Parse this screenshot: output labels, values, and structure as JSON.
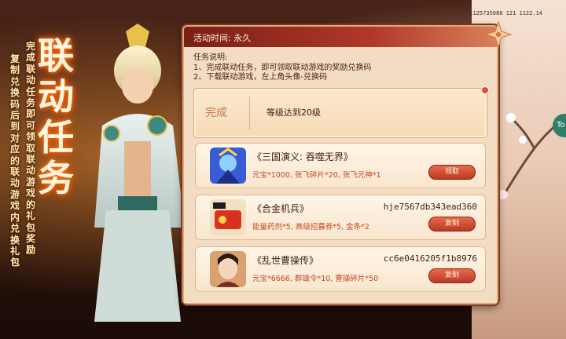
{
  "status_id": "1125735088 121 1122.14",
  "side_button_label": "To",
  "event": {
    "title_chars": [
      "联动",
      "任务"
    ],
    "vertical_cols": [
      "完成联动任务即可领取联动游戏的礼包奖励",
      "复制兑换码后到对应的联动游戏内兑换礼包"
    ]
  },
  "panel": {
    "activity_time": "活动时间: 永久",
    "description_lines": [
      "任务说明:",
      "1、完成联动任务，即可领取联动游戏的奖励兑换码",
      "2、下载联动游戏，左上角头像-兑换码"
    ],
    "task": {
      "status": "完成",
      "requirement": "等级达到20级"
    },
    "games": [
      {
        "title": "《三国演义: 吞噬无界》",
        "code": "",
        "reward": "元宝*1000, 张飞碎片*20, 张飞元神*1",
        "button": "领取",
        "icon": "blue-warrior-icon"
      },
      {
        "title": "《合金机兵》",
        "code": "hje7567db343ead360",
        "reward": "能量药剂*5, 高级招募券*5, 金条*2",
        "button": "复制",
        "icon": "red-mech-icon"
      },
      {
        "title": "《乱世曹操传》",
        "code": "cc6e0416205f1b8976",
        "reward": "元宝*6666, 群雄令*10, 曹操碎片*50",
        "button": "复制",
        "icon": "lady-portrait-icon"
      }
    ]
  }
}
